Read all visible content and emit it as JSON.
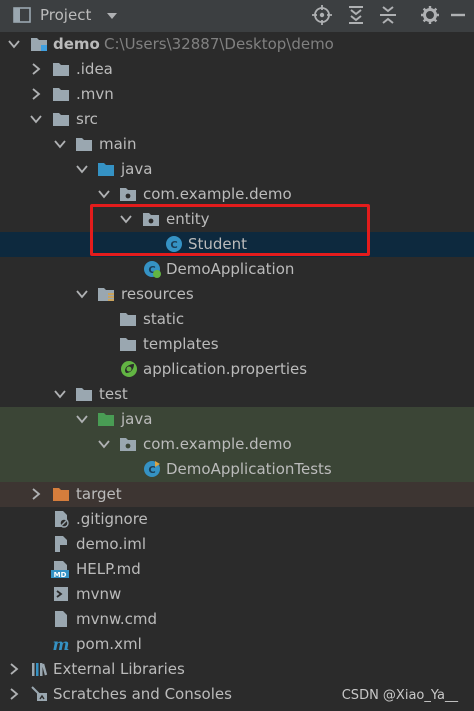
{
  "toolbar": {
    "title": "Project",
    "icons": [
      "project-view-icon",
      "dropdown-icon",
      "locate-icon",
      "expand-all-icon",
      "collapse-all-icon",
      "settings-icon",
      "hide-icon"
    ]
  },
  "tree": {
    "root": {
      "name": "demo",
      "path": "C:\\Users\\32887\\Desktop\\demo"
    },
    "idea": ".idea",
    "mvn": ".mvn",
    "src": "src",
    "main": "main",
    "java": "java",
    "package": "com.example.demo",
    "entity": "entity",
    "student": "Student",
    "demo_app": "DemoApplication",
    "resources": "resources",
    "static": "static",
    "templates": "templates",
    "app_props": "application.properties",
    "test": "test",
    "test_java": "java",
    "test_package": "com.example.demo",
    "tests_class": "DemoApplicationTests",
    "target": "target",
    "gitignore": ".gitignore",
    "demo_iml": "demo.iml",
    "help_md": "HELP.md",
    "mvnw": "mvnw",
    "mvnw_cmd": "mvnw.cmd",
    "pom": "pom.xml",
    "external_libs": "External Libraries",
    "scratches": "Scratches and Consoles"
  },
  "colors": {
    "selection": "#0d293e",
    "test_bg": "#3b4536",
    "excluded_bg": "#3d3532",
    "highlight_box": "#e31c1c"
  },
  "watermark": "CSDN @Xiao_Ya__"
}
